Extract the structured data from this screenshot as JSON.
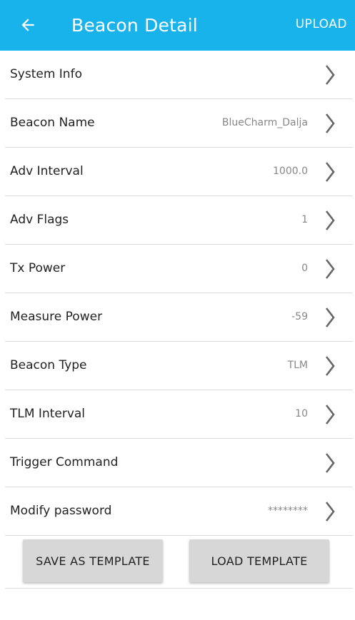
{
  "header": {
    "title": "Beacon Detail",
    "action_label": "UPLOAD",
    "back_icon": "arrow-left-icon",
    "background_color": "#19b3ec"
  },
  "rows": [
    {
      "label": "System Info",
      "value": ""
    },
    {
      "label": "Beacon Name",
      "value": "BlueCharm_Dalja"
    },
    {
      "label": "Adv Interval",
      "value": "1000.0"
    },
    {
      "label": "Adv Flags",
      "value": "1"
    },
    {
      "label": "Tx Power",
      "value": "0"
    },
    {
      "label": "Measure Power",
      "value": "-59"
    },
    {
      "label": "Beacon Type",
      "value": "TLM"
    },
    {
      "label": "TLM Interval",
      "value": "10"
    },
    {
      "label": "Trigger Command",
      "value": ""
    },
    {
      "label": "Modify password",
      "value": "********"
    }
  ],
  "buttons": {
    "save_template": "SAVE AS TEMPLATE",
    "load_template": "LOAD TEMPLATE"
  }
}
